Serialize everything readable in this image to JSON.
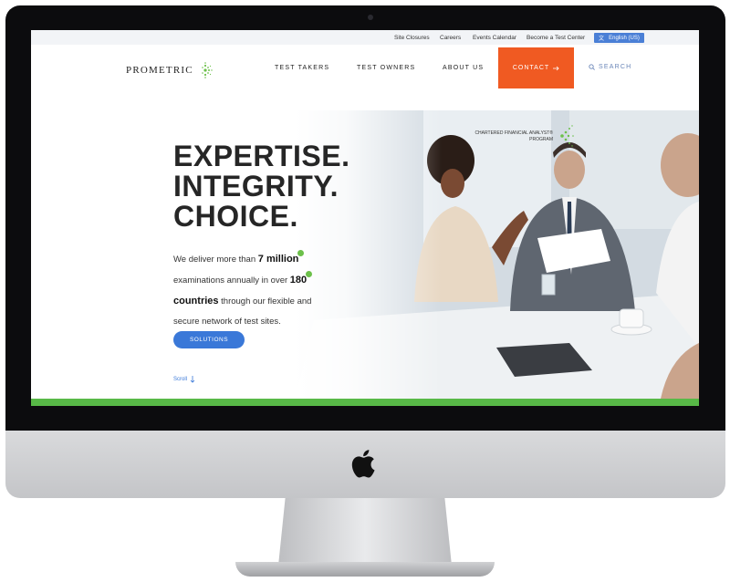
{
  "utility_nav": {
    "links": [
      "Site Closures",
      "Careers",
      "Events Calendar",
      "Become a Test Center"
    ],
    "language": "English (US)"
  },
  "brand": {
    "name": "PROMETRIC"
  },
  "main_nav": {
    "items": [
      "TEST TAKERS",
      "TEST OWNERS",
      "ABOUT US"
    ],
    "contact": "CONTACT",
    "search": "SEARCH"
  },
  "hero": {
    "headline_1": "EXPERTISE.",
    "headline_2": "INTEGRITY.",
    "headline_3": "CHOICE.",
    "body_1": "We deliver more than",
    "stat_1": "7 million",
    "body_2": "examinations annually in over",
    "stat_2": "180",
    "stat_3": "countries",
    "body_3": "through our flexible and secure network of test sites.",
    "cta": "SOLUTIONS",
    "scroll": "Scroll"
  },
  "partner_badge": {
    "line_1": "CHARTERED FINANCIAL ANALYST®",
    "line_2": "PROGRAM"
  },
  "colors": {
    "contact_orange": "#f05a22",
    "link_blue": "#3a78d8",
    "brand_green": "#58b947"
  },
  "icons": [
    "translate-icon",
    "arrow-right-icon",
    "search-icon",
    "arrow-down-icon",
    "apple-icon"
  ]
}
